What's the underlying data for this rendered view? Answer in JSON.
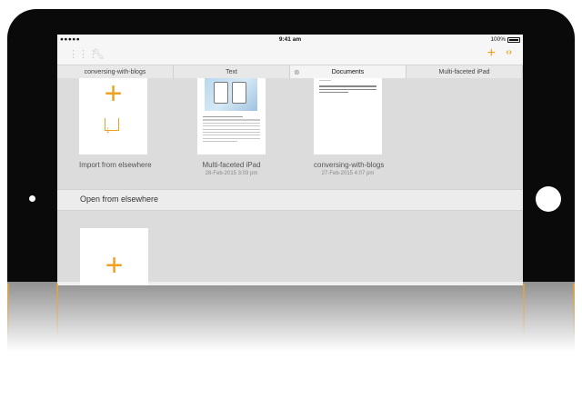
{
  "status": {
    "carrier": "●●●●● ",
    "time": "9:41 am",
    "battery": "100%"
  },
  "toolbar": {
    "grid_icon": "grid-icon",
    "tool_icon": "wrench-icon",
    "add_icon": "+",
    "code_icon": "‹›"
  },
  "tabs": [
    {
      "label": "conversing-with-blogs"
    },
    {
      "label": "Text"
    },
    {
      "label": "Documents"
    },
    {
      "label": "Multi-faceted iPad"
    }
  ],
  "documents": [
    {
      "title": "Import from elsewhere",
      "date": ""
    },
    {
      "title": "Multi-faceted iPad",
      "date": "28-Feb-2015 3:03 pm"
    },
    {
      "title": "conversing-with-blogs",
      "date": "27-Feb-2015 4:07 pm"
    }
  ],
  "section": {
    "title": "Open from elsewhere"
  },
  "colors": {
    "accent": "#f0a020",
    "device": "#0a0a0a"
  }
}
